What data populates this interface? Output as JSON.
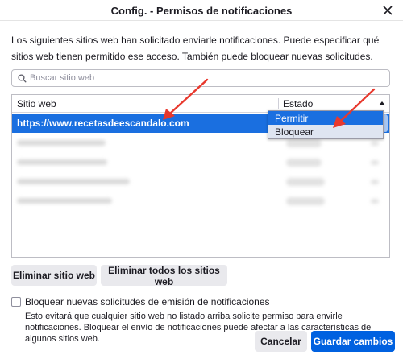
{
  "dialog": {
    "title": "Config. - Permisos de notificaciones",
    "description": "Los siguientes sitios web han solicitado enviarle notificaciones. Puede especificar qué sitios web tienen permitido ese acceso. También puede bloquear nuevas solicitudes."
  },
  "search": {
    "placeholder": "Buscar sitio web"
  },
  "table": {
    "columns": [
      "Sitio web",
      "Estado"
    ],
    "selected_row": {
      "site": "https://www.recetasdeescandalo.com"
    }
  },
  "dropdown": {
    "options": [
      "Permitir",
      "Bloquear"
    ],
    "selected": "Permitir",
    "hovered": "Bloquear"
  },
  "buttons": {
    "remove": "Eliminar sitio web",
    "remove_all": "Eliminar todos los sitios web",
    "cancel": "Cancelar",
    "save": "Guardar cambios"
  },
  "block_new": {
    "label": "Bloquear nuevas solicitudes de emisión de notificaciones",
    "note": "Esto evitará que cualquier sitio web no listado arriba solicite permiso para envirle notificaciones. Bloquear el envío de notificaciones puede afectar a las características de algunos sitios web."
  },
  "colors": {
    "selection": "#1a6fe0",
    "primary_button": "#0061e0",
    "annotation_arrow": "#e8382d"
  },
  "icons": {
    "close": "close-icon",
    "search": "search-icon",
    "sort": "sort-ascending-icon"
  }
}
